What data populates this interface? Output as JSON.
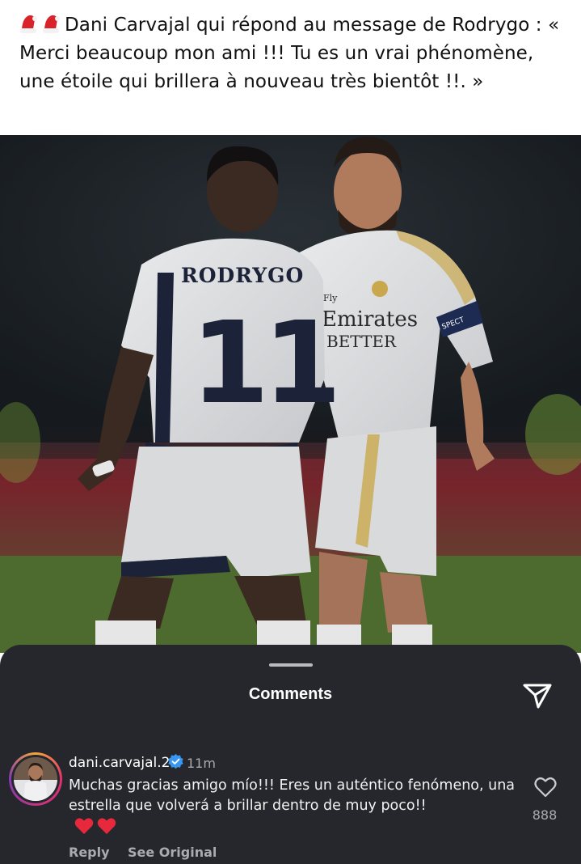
{
  "post": {
    "caption_emoji_icons": [
      "santa-hat-icon",
      "santa-hat-icon"
    ],
    "caption": "Dani Carvajal qui répond au message de Rodrygo : « Merci beaucoup mon ami !!! Tu es un vrai phénomène, une étoile qui brillera à nouveau très bientôt !!. »",
    "photo": {
      "player_name_on_shirt": "RODRYGO",
      "shirt_number": "11",
      "sponsor_line1": "Fly",
      "sponsor_line2": "Emirates",
      "sponsor_line3": "BETTER",
      "armband_text": "SPECT"
    }
  },
  "comments_sheet": {
    "title": "Comments",
    "share_icon": "paper-plane-icon",
    "comment": {
      "username": "dani.carvajal.2",
      "verified": true,
      "time": "11m",
      "text": "Muchas gracias amigo mío!!! Eres un auténtico fenómeno, una estrella que volverá a brillar dentro de muy poco!!",
      "emoji": [
        "red-heart-icon",
        "red-heart-icon"
      ],
      "reply_label": "Reply",
      "see_original_label": "See Original",
      "like_icon": "heart-outline-icon",
      "like_count": "888"
    }
  },
  "colors": {
    "sheet_bg": "#25272c",
    "text_secondary": "#a8abb1",
    "verified_blue": "#3897f0",
    "heart_red": "#e8283c"
  }
}
